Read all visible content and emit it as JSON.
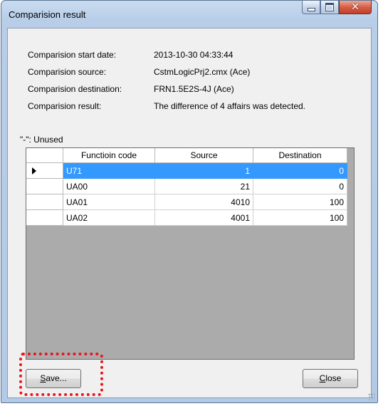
{
  "window": {
    "title": "Comparision result"
  },
  "info": [
    {
      "label": "Comparision start date:",
      "value": "2013-10-30 04:33:44"
    },
    {
      "label": "Comparision source:",
      "value": "CstmLogicPrj2.cmx (Ace)"
    },
    {
      "label": "Comparision destination:",
      "value": "FRN1.5E2S-4J (Ace)"
    },
    {
      "label": "Comparision result:",
      "value": "The difference of 4 affairs was detected."
    }
  ],
  "unused_note": "\"-\": Unused",
  "grid": {
    "columns": [
      "Functioin code",
      "Source",
      "Destination"
    ],
    "rows": [
      {
        "code": "U71",
        "source": "1",
        "destination": "0",
        "selected": true
      },
      {
        "code": "UA00",
        "source": "21",
        "destination": "0",
        "selected": false
      },
      {
        "code": "UA01",
        "source": "4010",
        "destination": "100",
        "selected": false
      },
      {
        "code": "UA02",
        "source": "4001",
        "destination": "100",
        "selected": false
      }
    ]
  },
  "buttons": {
    "save_mnemonic": "S",
    "save_rest": "ave...",
    "close_mnemonic": "C",
    "close_rest": "lose"
  },
  "colors": {
    "selection": "#3399ff",
    "highlight": "#e8151b"
  },
  "icons": {
    "minimize": "minimize-icon",
    "maximize": "maximize-icon",
    "close": "close-icon",
    "row_pointer": "row-pointer-icon"
  }
}
